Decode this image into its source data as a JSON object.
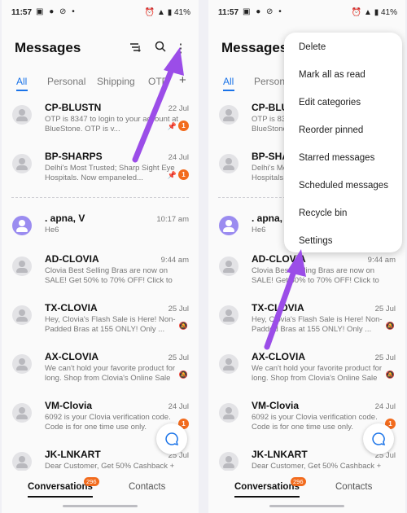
{
  "status_bar": {
    "time": "11:57",
    "battery": "41%"
  },
  "header": {
    "title": "Messages"
  },
  "tabs": [
    "All",
    "Personal",
    "Shipping",
    "OTP"
  ],
  "conversations": [
    {
      "sender": "CP-BLUSTN",
      "preview": "OTP is 8347 to login to your account at BlueStone. OTP is v...",
      "time": "22 Jul",
      "pinned": true,
      "unread": "1"
    },
    {
      "sender": "BP-SHARPS",
      "preview": "Delhi's Most Trusted; Sharp Sight Eye Hospitals. Now empaneled...",
      "time": "24 Jul",
      "pinned": true,
      "unread": "1"
    },
    {
      "sender": ". apna, V",
      "preview": "He6",
      "time": "10:17 am"
    },
    {
      "sender": "AD-CLOVIA",
      "preview": "Clovia Best Selling Bras are now on SALE! Get 50% to 70% OFF! Click to Sho...",
      "time": "9:44 am"
    },
    {
      "sender": "TX-CLOVIA",
      "preview": "Hey, Clovia's Flash Sale is Here! Non-Padded Bras at 155 ONLY! Only ...",
      "time": "25 Jul",
      "muted": true
    },
    {
      "sender": "AX-CLOVIA",
      "preview": "We can't hold your favorite product for long. Shop from Clovia's Online Sale an...",
      "time": "25 Jul",
      "muted": true
    },
    {
      "sender": "VM-Clovia",
      "preview": "6092 is your Clovia verification code. Code is for one time use only.",
      "time": "24 Jul",
      "unread": "1"
    },
    {
      "sender": "JK-LNKART",
      "preview": "Dear Customer, Get 50% Cashback +",
      "time": "25 Jul"
    }
  ],
  "bottom_nav": {
    "conversations": "Conversations",
    "conversations_count": "296",
    "contacts": "Contacts"
  },
  "menu": [
    "Delete",
    "Mark all as read",
    "Edit categories",
    "Reorder pinned",
    "Starred messages",
    "Scheduled messages",
    "Recycle bin",
    "Settings"
  ],
  "annotation_color": "#9b4de8",
  "accent_color": "#1a73e8",
  "badge_color": "#f26b1d"
}
